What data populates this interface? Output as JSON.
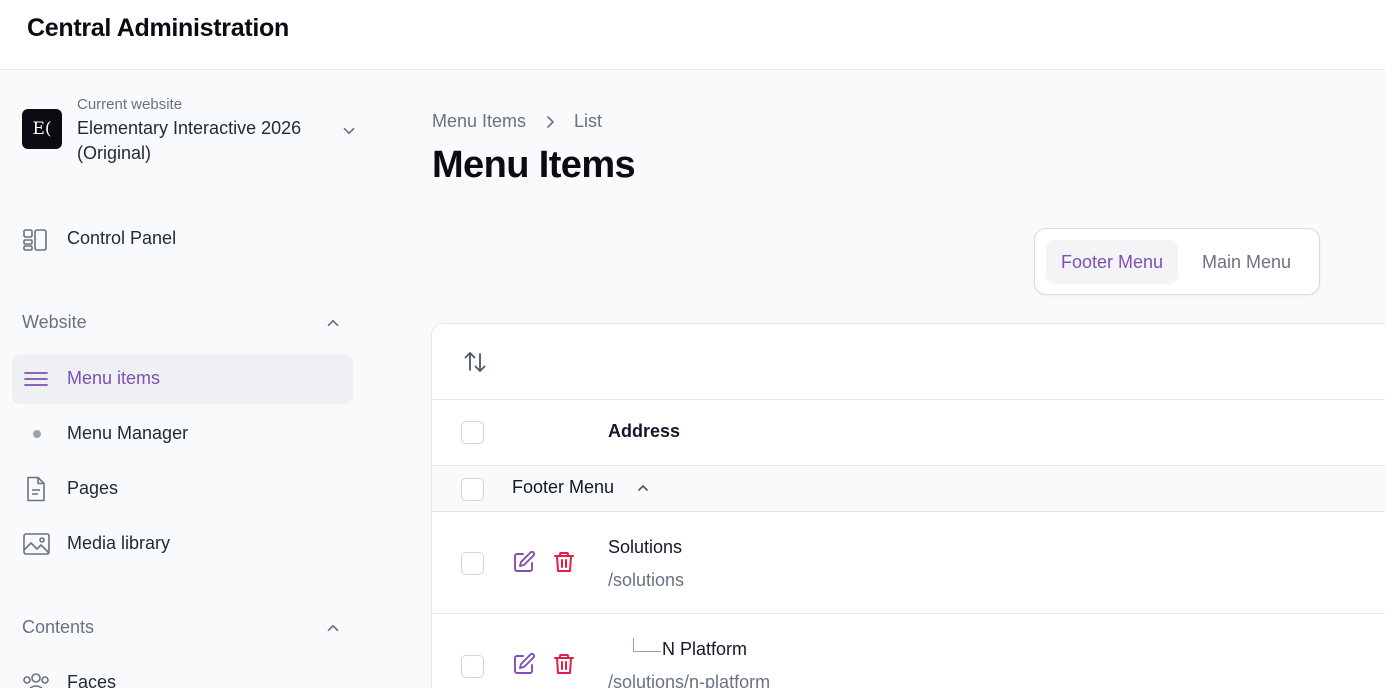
{
  "app": {
    "title": "Central Administration"
  },
  "site_switcher": {
    "caption": "Current website",
    "name": "Elementary Interactive 2026 (Original)",
    "avatar_text": "E("
  },
  "sidebar": {
    "control_panel": {
      "label": "Control Panel",
      "icon": "dashboard-icon"
    },
    "groups": [
      {
        "label": "Website",
        "items": [
          {
            "label": "Menu items",
            "icon": "menu-lines-icon",
            "active": true
          },
          {
            "label": "Menu Manager",
            "icon": "dot-icon",
            "active": false
          },
          {
            "label": "Pages",
            "icon": "document-icon",
            "active": false
          },
          {
            "label": "Media library",
            "icon": "image-icon",
            "active": false
          }
        ]
      },
      {
        "label": "Contents",
        "items": [
          {
            "label": "Faces",
            "icon": "users-icon",
            "active": false
          }
        ]
      }
    ]
  },
  "breadcrumb": {
    "items": [
      "Menu Items",
      "List"
    ]
  },
  "page": {
    "title": "Menu Items"
  },
  "tabs": [
    {
      "label": "Footer Menu",
      "active": true
    },
    {
      "label": "Main Menu",
      "active": false
    }
  ],
  "table": {
    "columns": [
      "Address"
    ],
    "groups": [
      {
        "label": "Footer Menu",
        "rows": [
          {
            "title": "Solutions",
            "path": "/solutions",
            "depth": 0
          },
          {
            "title": "N Platform",
            "path": "/solutions/n-platform",
            "depth": 1
          }
        ]
      }
    ]
  },
  "colors": {
    "accent": "#7e4fb5",
    "danger": "#e11d48",
    "text": "#111827",
    "muted": "#6b7280"
  }
}
